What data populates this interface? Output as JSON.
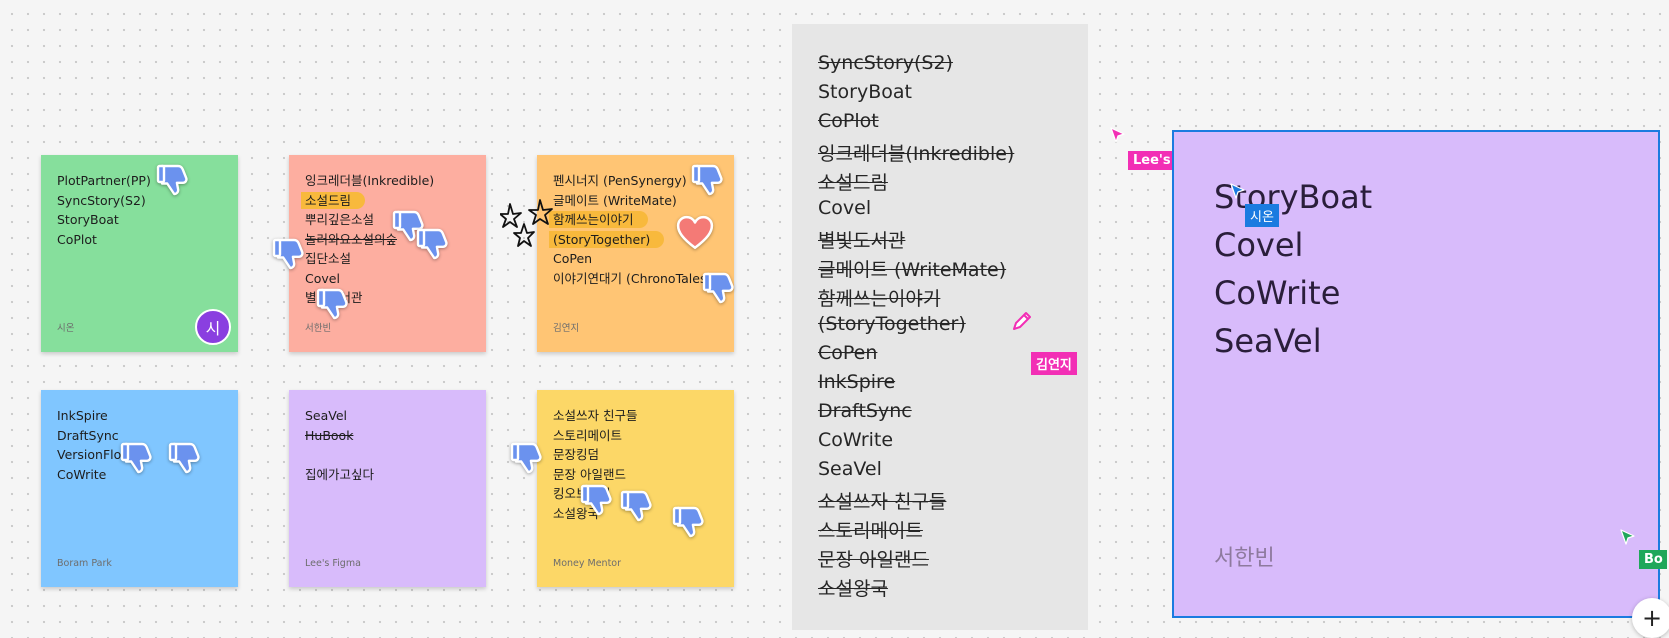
{
  "colors": {
    "green": "#86df9c",
    "salmon": "#fdaea0",
    "orange": "#ffc574",
    "blue": "#80c6ff",
    "purple": "#d8bbfb",
    "yellow": "#fcd767",
    "highlight": "#f8b93c",
    "vote_blue": "#6b92ee",
    "grey_panel": "#e6e6e6",
    "frame_border": "#1b7be0"
  },
  "stickies": [
    {
      "color": "green",
      "lines": [
        {
          "text": "PlotPartner(PP)"
        },
        {
          "text": "SyncStory(S2)"
        },
        {
          "text": "StoryBoat"
        },
        {
          "text": "CoPlot"
        }
      ],
      "author": "시온",
      "avatar": "시"
    },
    {
      "color": "salmon",
      "lines": [
        {
          "text": "잉크레더블(Inkredible)"
        },
        {
          "text": "소설드림",
          "highlight": true
        },
        {
          "text": "뿌리깊은소설"
        },
        {
          "text": "놀러와요소설의숲",
          "strike": true
        },
        {
          "text": "집단소설"
        },
        {
          "text": "Covel"
        },
        {
          "text": "별빛도서관"
        }
      ],
      "author": "서한빈"
    },
    {
      "color": "orange",
      "lines": [
        {
          "text": "펜시너지 (PenSynergy)"
        },
        {
          "text": "글메이트 (WriteMate)"
        },
        {
          "text": "함께쓰는이야기",
          "highlight": true
        },
        {
          "text": "(StoryTogether)",
          "highlight": true
        },
        {
          "text": "CoPen"
        },
        {
          "text": "이야기연대기 (ChronoTales)"
        }
      ],
      "author": "김연지"
    },
    {
      "color": "blue",
      "lines": [
        {
          "text": "InkSpire"
        },
        {
          "text": "DraftSync"
        },
        {
          "text": "VersionFlow"
        },
        {
          "text": "CoWrite"
        }
      ],
      "author": "Boram Park"
    },
    {
      "color": "purple",
      "lines": [
        {
          "text": "SeaVel"
        },
        {
          "text": "HuBook",
          "strike": true
        },
        {
          "text": ""
        },
        {
          "text": "집에가고싶다"
        }
      ],
      "author": "Lee's Figma"
    },
    {
      "color": "yellow",
      "lines": [
        {
          "text": "소설쓰자 친구들"
        },
        {
          "text": "스토리메이트"
        },
        {
          "text": "문장킹덤"
        },
        {
          "text": "문장 아일랜드"
        },
        {
          "text": "킹오브소설"
        },
        {
          "text": "소설왕국"
        }
      ],
      "author": "Money Mentor"
    }
  ],
  "name_list": [
    {
      "text": "SyncStory(S2)",
      "strike": true
    },
    {
      "text": "StoryBoat",
      "strike": false
    },
    {
      "text": "CoPlot",
      "strike": true
    },
    {
      "text": "잉크레더블(Inkredible)",
      "strike": true
    },
    {
      "text": "소설드림",
      "strike": true
    },
    {
      "text": "Covel",
      "strike": false
    },
    {
      "text": "별빛도서관",
      "strike": true
    },
    {
      "text": "글메이트 (WriteMate)",
      "strike": true
    },
    {
      "text": "함께쓰는이야기",
      "strike": true
    },
    {
      "text": "(StoryTogether)",
      "strike": true
    },
    {
      "text": "CoPen",
      "strike": true
    },
    {
      "text": "InkSpire",
      "strike": true
    },
    {
      "text": "DraftSync",
      "strike": true
    },
    {
      "text": "CoWrite",
      "strike": false
    },
    {
      "text": "SeaVel",
      "strike": false
    },
    {
      "text": "소설쓰자 친구들",
      "strike": true
    },
    {
      "text": "스토리메이트",
      "strike": true
    },
    {
      "text": "문장 아일랜드",
      "strike": true
    },
    {
      "text": "소설왕국",
      "strike": true
    }
  ],
  "final_frame": {
    "items": [
      "StoryBoat",
      "Covel",
      "CoWrite",
      "SeaVel"
    ],
    "author": "서한빈"
  },
  "cursors": [
    {
      "label": "Lee's Figma",
      "color": "#f22fb5"
    },
    {
      "label": "시온",
      "color": "#1b7be0"
    },
    {
      "label": "김연지",
      "color": "#f22fb5"
    },
    {
      "label": "Bo",
      "color": "#1fa75a"
    }
  ],
  "zoom_button": "+"
}
